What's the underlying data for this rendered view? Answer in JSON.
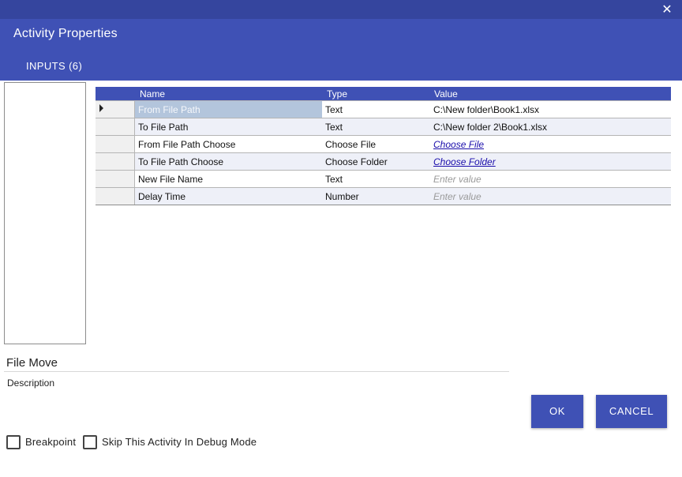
{
  "dialog": {
    "title": "Activity Properties",
    "close_icon": "close-icon",
    "tab_label": "INPUTS (6)"
  },
  "grid": {
    "columns": [
      "Name",
      "Type",
      "Value"
    ],
    "rows": [
      {
        "name": "From File Path",
        "type": "Text",
        "value": "C:\\New folder\\Book1.xlsx",
        "kind": "text",
        "selected": true
      },
      {
        "name": "To File Path",
        "type": "Text",
        "value": "C:\\New folder 2\\Book1.xlsx",
        "kind": "text",
        "selected": false
      },
      {
        "name": "From File Path Choose",
        "type": "Choose File",
        "value": "Choose File",
        "kind": "link",
        "selected": false
      },
      {
        "name": "To File Path Choose",
        "type": "Choose Folder",
        "value": "Choose Folder",
        "kind": "link",
        "selected": false
      },
      {
        "name": "New File Name",
        "type": "Text",
        "value": "Enter value",
        "kind": "placeholder",
        "selected": false
      },
      {
        "name": "Delay Time",
        "type": "Number",
        "value": "Enter value",
        "kind": "placeholder",
        "selected": false
      }
    ]
  },
  "activity": {
    "name": "File Move",
    "description_label": "Description"
  },
  "buttons": {
    "ok": "OK",
    "cancel": "CANCEL"
  },
  "options": {
    "breakpoint": "Breakpoint",
    "skip_debug": "Skip This Activity In Debug Mode"
  },
  "colors": {
    "primary": "#3f51b5",
    "header_top": "#35459e",
    "selected_cell": "#b3c5dc",
    "link": "#1a0dab"
  }
}
